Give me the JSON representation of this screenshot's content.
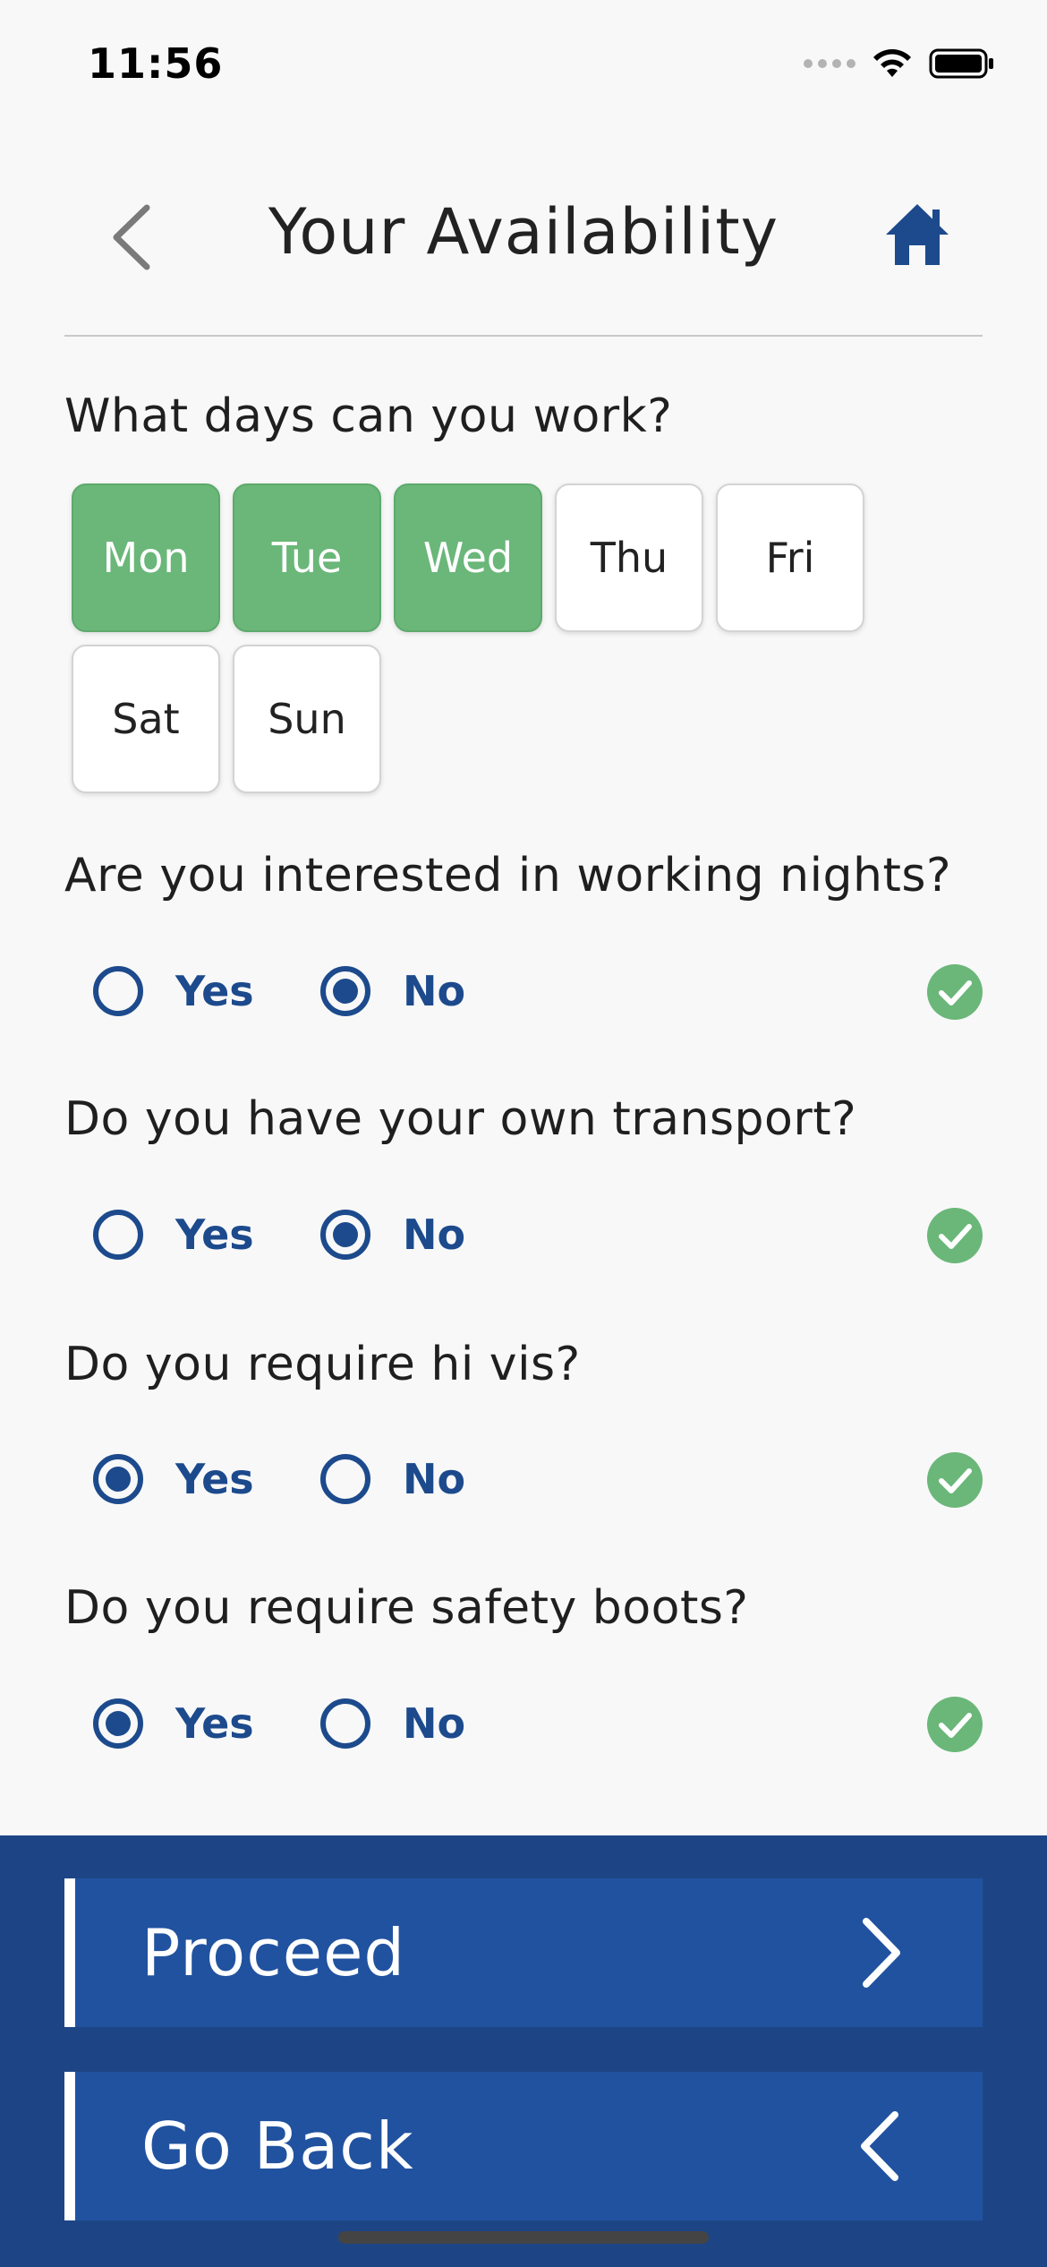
{
  "status_bar": {
    "time": "11:56"
  },
  "header": {
    "title": "Your Availability"
  },
  "days_question": "What days can you work?",
  "days": [
    {
      "label": "Mon",
      "selected": true
    },
    {
      "label": "Tue",
      "selected": true
    },
    {
      "label": "Wed",
      "selected": true
    },
    {
      "label": "Thu",
      "selected": false
    },
    {
      "label": "Fri",
      "selected": false
    },
    {
      "label": "Sat",
      "selected": false
    },
    {
      "label": "Sun",
      "selected": false
    }
  ],
  "questions": [
    {
      "text": "Are you interested in working nights?",
      "yes_label": "Yes",
      "no_label": "No",
      "selected": "No",
      "answered": true
    },
    {
      "text": "Do you have your own transport?",
      "yes_label": "Yes",
      "no_label": "No",
      "selected": "No",
      "answered": true
    },
    {
      "text": "Do you require hi vis?",
      "yes_label": "Yes",
      "no_label": "No",
      "selected": "Yes",
      "answered": true
    },
    {
      "text": "Do you require safety boots?",
      "yes_label": "Yes",
      "no_label": "No",
      "selected": "Yes",
      "answered": true
    }
  ],
  "footer": {
    "proceed_label": "Proceed",
    "go_back_label": "Go Back"
  },
  "colors": {
    "accent": "#1c4a8c",
    "selected_day": "#6ab779",
    "check": "#6ab779",
    "footer_bg": "#1d4585",
    "button_bg": "#2152a0"
  }
}
